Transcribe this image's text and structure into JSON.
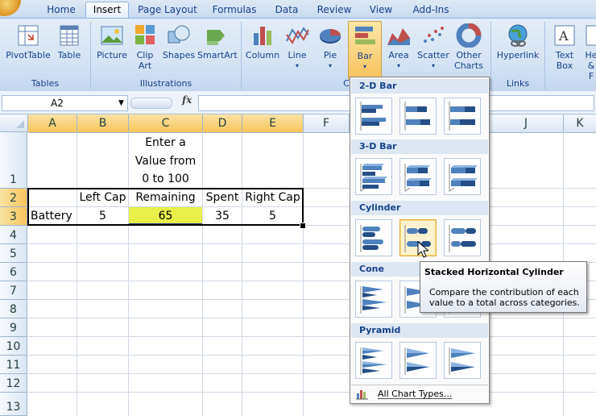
{
  "ribbon": {
    "tabs": [
      "Home",
      "Insert",
      "Page Layout",
      "Formulas",
      "Data",
      "Review",
      "View",
      "Add-Ins"
    ],
    "active_tab": "Insert",
    "groups": {
      "tables": {
        "label": "Tables",
        "buttons": [
          "PivotTable",
          "Table"
        ]
      },
      "illustrations": {
        "label": "Illustrations",
        "buttons": [
          "Picture",
          "Clip Art",
          "Shapes",
          "SmartArt"
        ]
      },
      "charts": {
        "label": "Charts",
        "buttons": [
          "Column",
          "Line",
          "Pie",
          "Bar",
          "Area",
          "Scatter",
          "Other Charts"
        ]
      },
      "links": {
        "label": "Links",
        "buttons": [
          "Hyperlink"
        ]
      },
      "text": {
        "buttons": [
          "Text Box",
          "He & F"
        ]
      }
    }
  },
  "formula_bar": {
    "name_box": "A2",
    "fx": "fx",
    "formula": ""
  },
  "sheet": {
    "columns": [
      "A",
      "B",
      "C",
      "D",
      "E",
      "F",
      "G",
      "H",
      "I",
      "J",
      "K"
    ],
    "rows": [
      "1",
      "2",
      "3",
      "4",
      "5",
      "6",
      "7",
      "8",
      "9",
      "10",
      "11",
      "12",
      "13"
    ],
    "cells": {
      "C1": [
        "Enter a",
        "Value from",
        "0 to 100"
      ],
      "B2": "Left Cap",
      "C2": "Remaining",
      "D2": "Spent",
      "E2": "Right Cap",
      "A3": "Battery",
      "B3": "5",
      "C3": "65",
      "D3": "35",
      "E3": "5"
    },
    "highlight_color": "#e8ef4a"
  },
  "bar_menu": {
    "sections": [
      "2-D Bar",
      "3-D Bar",
      "Cylinder",
      "Cone",
      "Pyramid"
    ],
    "hovered": "Stacked Horizontal Cylinder",
    "footer": "All Chart Types..."
  },
  "tooltip": {
    "title": "Stacked Horizontal Cylinder",
    "body_line1": "Compare the contribution of each",
    "body_line2": "value to a total across categories."
  },
  "colors": {
    "accent": "#15428b",
    "ribbon": "#d5e3f4",
    "hover": "#f8c45c"
  }
}
